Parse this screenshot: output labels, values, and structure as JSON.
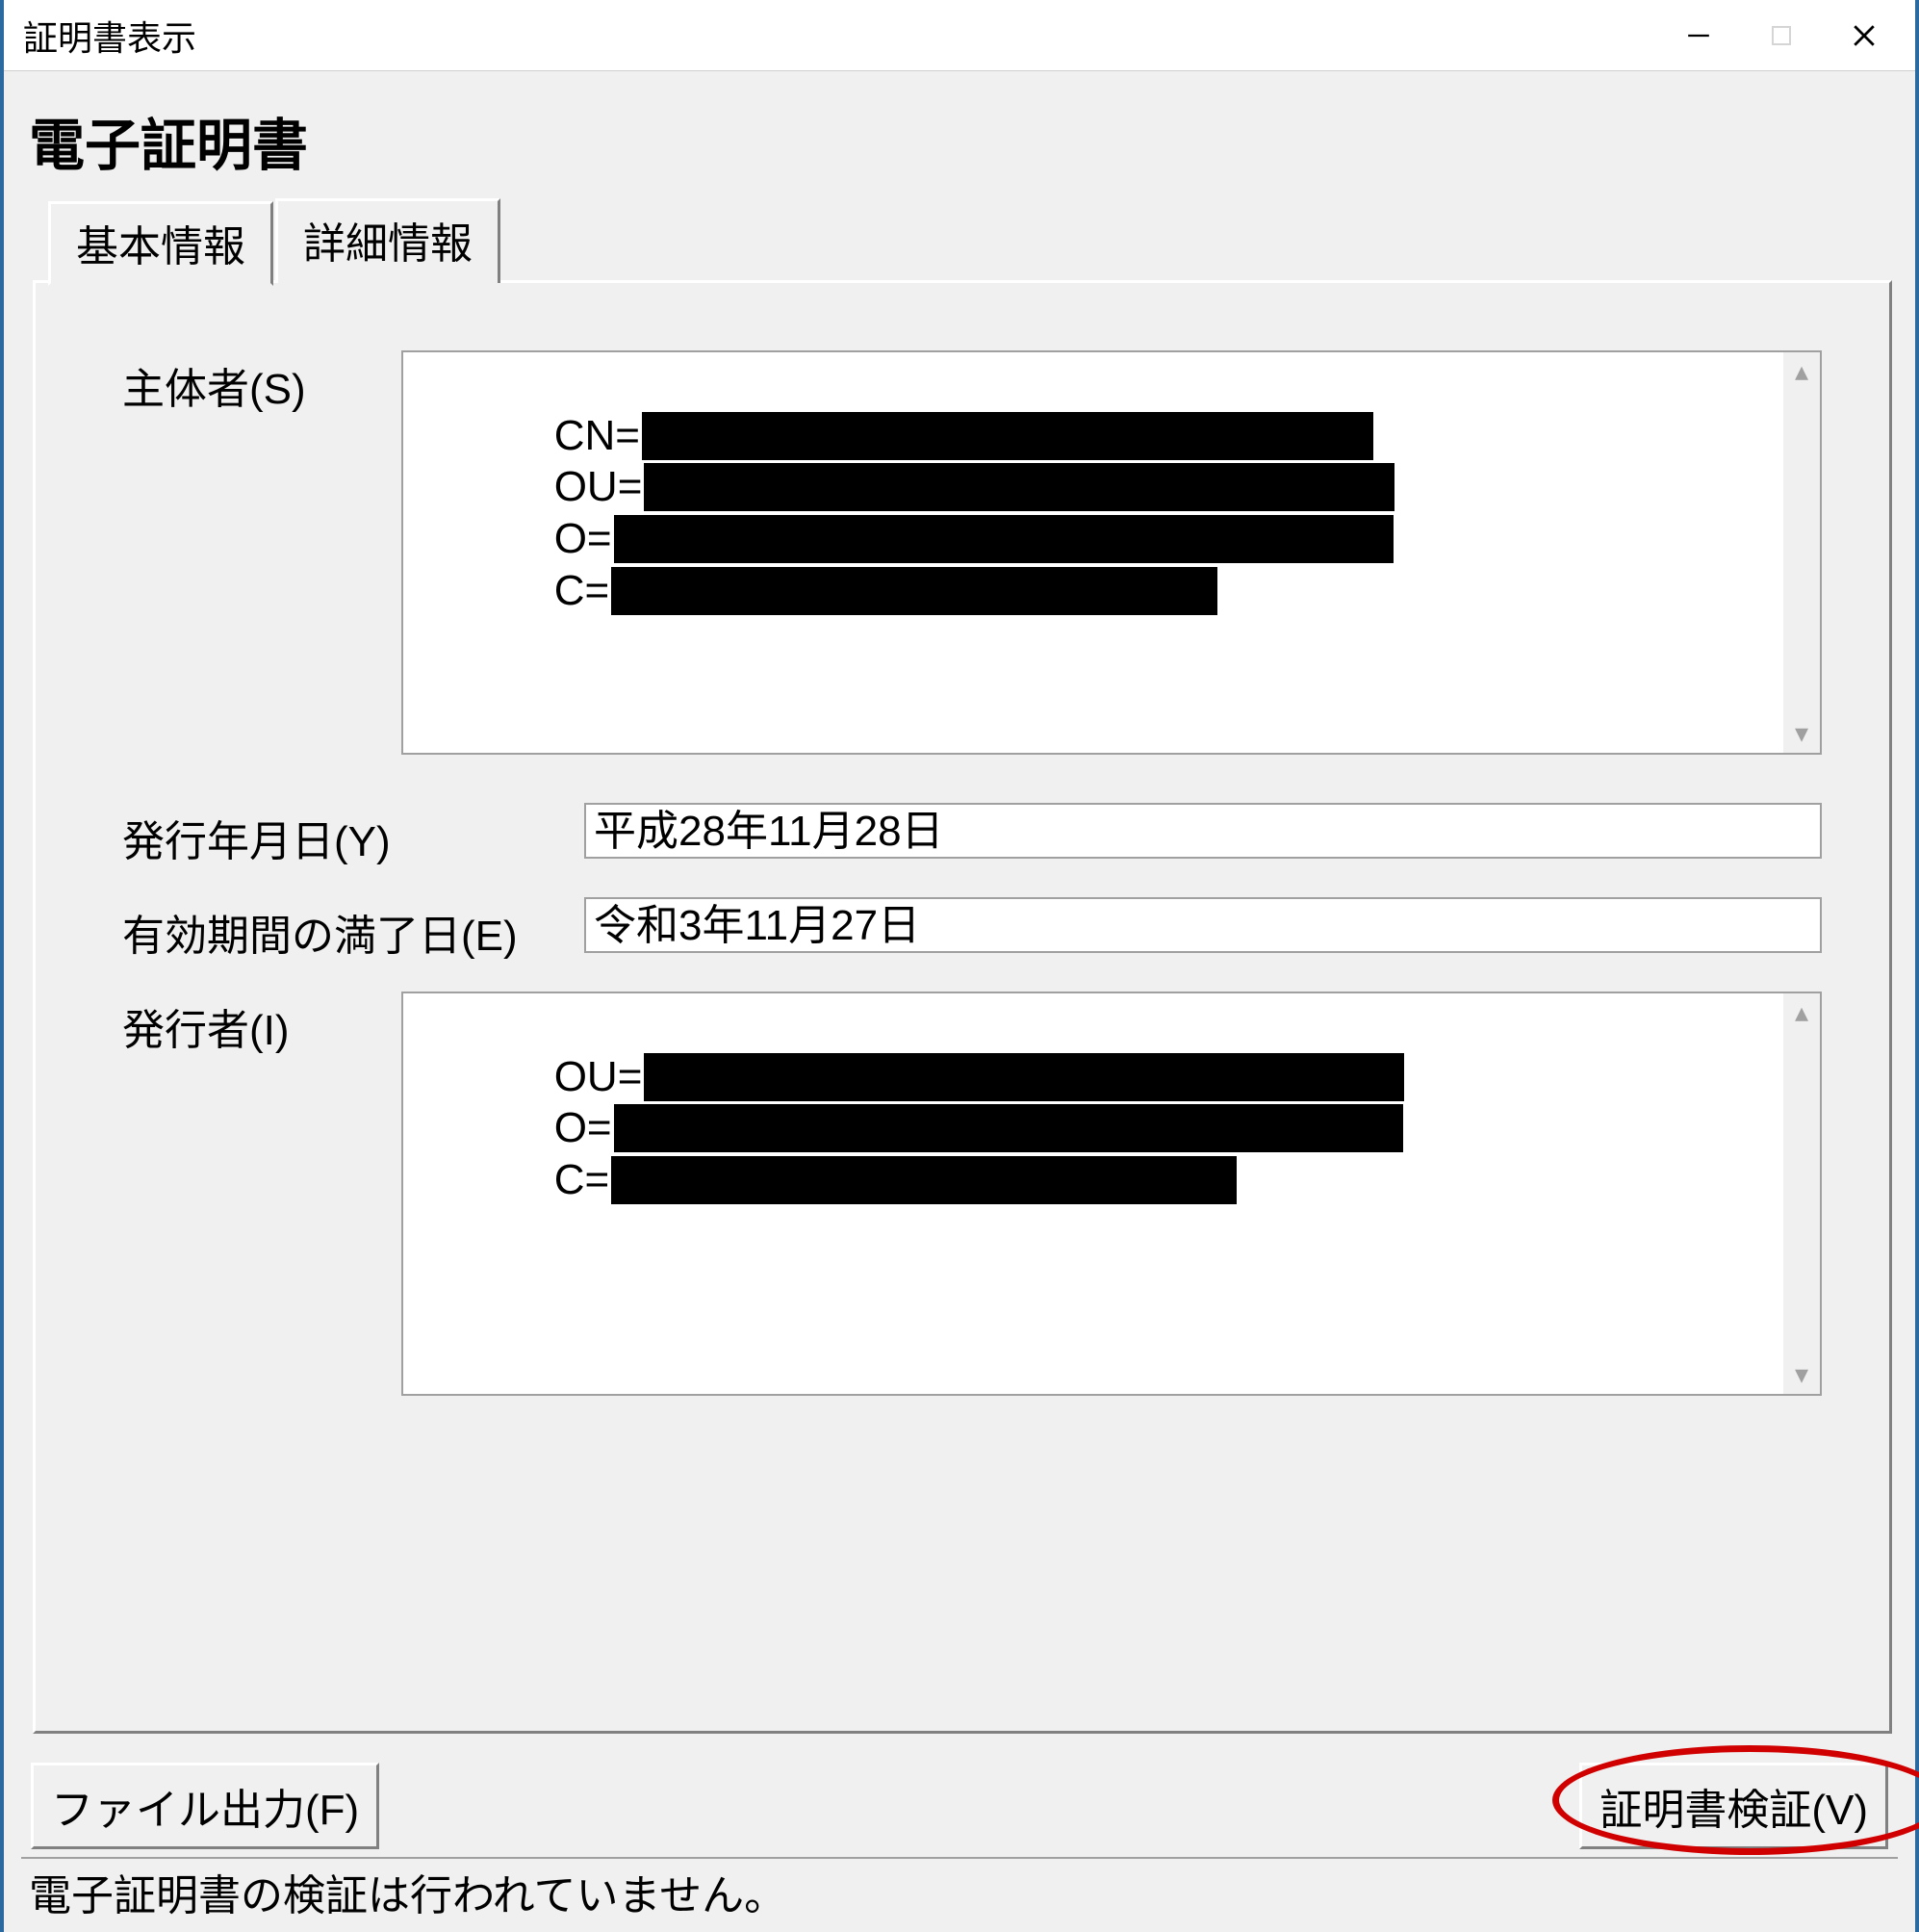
{
  "window": {
    "title": "証明書表示"
  },
  "heading": "電子証明書",
  "tabs": {
    "basic": "基本情報",
    "detail": "詳細情報"
  },
  "fields": {
    "subject_label": "主体者(S)",
    "subject_lines": {
      "l0": "CN=",
      "l1": "OU=",
      "l2": "O=",
      "l3": "C="
    },
    "issue_date_label": "発行年月日(Y)",
    "issue_date_value": "平成28年11月28日",
    "expiry_label": "有効期間の満了日(E)",
    "expiry_value": "令和3年11月27日",
    "issuer_label": "発行者(I)",
    "issuer_lines": {
      "l0": "OU=",
      "l1": "O=",
      "l2": "C="
    }
  },
  "buttons": {
    "file_output": "ファイル出力(F)",
    "verify": "証明書検証(V)"
  },
  "status": "電子証明書の検証は行われていません。"
}
